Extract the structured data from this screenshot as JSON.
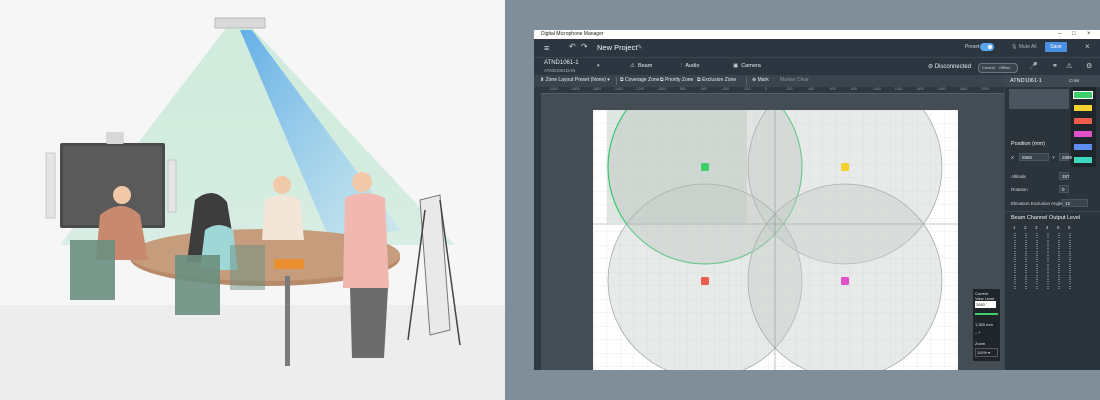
{
  "app": {
    "window_title": "Digital Microphone Manager",
    "project_name": "New Project",
    "preset_label": "Preset",
    "mute_all_label": "Mute All",
    "save_label": "Save"
  },
  "device": {
    "name": "ATND1061-1",
    "model": "ATND1061DAN",
    "status": "Disconnected",
    "control_left": "Control",
    "control_right": "Offline"
  },
  "mode_tabs": [
    "Beam",
    "Audio",
    "Camera"
  ],
  "toolbar": {
    "zone_preset": "Zone Layout Preset (None)",
    "coverage_zone": "Coverage Zone",
    "priority_zone": "Priority Zone",
    "exclusion_zone": "Exclusion Zone",
    "mark": "Mark",
    "marker_clear": "Marker Clear"
  },
  "ruler_ticks": [
    "-2000",
    "-1800",
    "-1600",
    "-1400",
    "-1200",
    "-1000",
    "-800",
    "-600",
    "-400",
    "-200",
    "0",
    "200",
    "400",
    "600",
    "800",
    "1000",
    "1200",
    "1400",
    "1600",
    "1800",
    "2000"
  ],
  "view_level": {
    "title": "Current View Level",
    "value": "2650",
    "mm_value": "1,350",
    "unit": "mm",
    "zoom_label": "Zoom",
    "zoom_value": "110%"
  },
  "sidebar": {
    "device_name": "ATND1061-1",
    "color_label": "Color",
    "colors": [
      "#3ccf6a",
      "#f4d12e",
      "#ef5b4c",
      "#e050c8",
      "#5b8ef0",
      "#3fd6c0"
    ],
    "position_title": "Position (mm)",
    "x_label": "X",
    "x_value": "5560",
    "y_label": "Y",
    "y_value": "2889",
    "altitude_label": "Altitude",
    "altitude_value": "287",
    "rotation_label": "Rotation",
    "rotation_value": "0",
    "elev_label": "Elevation Exclusion Angle",
    "elev_value": "12",
    "meter_title": "Beam Channel Output Level",
    "meter_channels": [
      "1",
      "2",
      "3",
      "4",
      "5",
      "6"
    ]
  },
  "beams": [
    {
      "id": "beam-1",
      "color": "#3ccf6a",
      "active": true
    },
    {
      "id": "beam-2",
      "color": "#f4d12e",
      "active": false
    },
    {
      "id": "beam-3",
      "color": "#ef5b4c",
      "active": false
    },
    {
      "id": "beam-4",
      "color": "#e050c8",
      "active": false
    }
  ]
}
